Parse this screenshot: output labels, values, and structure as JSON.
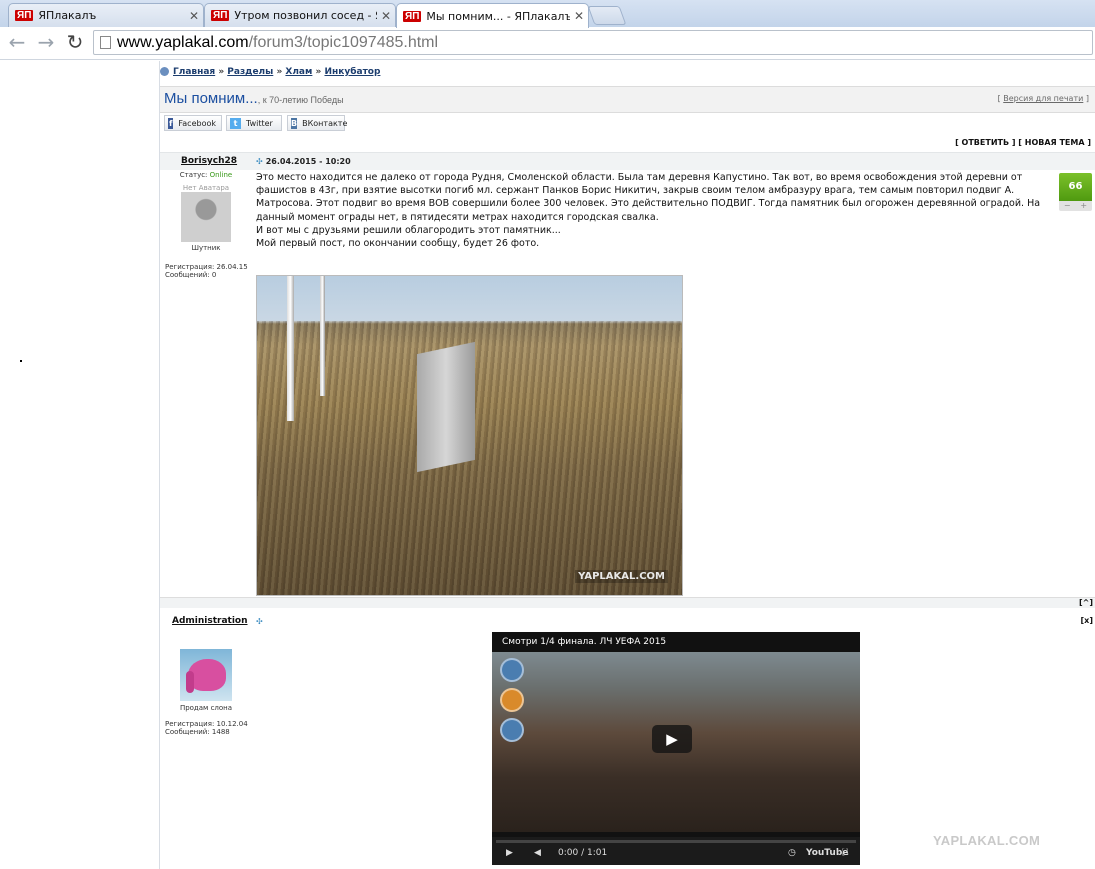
{
  "browser": {
    "tabs": [
      {
        "favicon": "ЯП",
        "title": "ЯПлакалъ"
      },
      {
        "favicon": "ЯП",
        "title": "Утром позвонил сосед - ЯП"
      },
      {
        "favicon": "ЯП",
        "title": "Мы помним... - ЯПлакалъ"
      }
    ],
    "url_host": "www.yaplakal.com",
    "url_path": "/forum3/topic1097485.html"
  },
  "breadcrumbs": [
    "Главная",
    "Разделы",
    "Хлам",
    "Инкубатор"
  ],
  "breadcrumb_sep": "»",
  "topic": {
    "title": "Мы помним...",
    "subtitle": ", к 70-летию Победы",
    "print_version": "Версия для печати"
  },
  "share": [
    {
      "label": "Facebook",
      "icon": "f",
      "color": "#3b5998"
    },
    {
      "label": "Twitter",
      "icon": "t",
      "color": "#55acee"
    },
    {
      "label": "ВКонтакте",
      "icon": "В",
      "color": "#4c75a3"
    }
  ],
  "actions": "[ ОТВЕТИТЬ ] [ НОВАЯ ТЕМА ]",
  "posts": [
    {
      "author": "Borisych28",
      "date": "26.04.2015 - 10:20",
      "status_label": "Статус:",
      "status": "Online",
      "avatar_text": "Нет Аватара",
      "rank": "Шутник",
      "registered": "Регистрация: 26.04.15",
      "messages": "Сообщений: 0",
      "rating": "66",
      "rating_minus": "−",
      "rating_plus": "+",
      "text1": "Это место находится не далеко от города Рудня, Смоленской области. Была там деревня Капустино. Так вот, во время освобождения этой деревни от фашистов в 43г, при взятие высотки погиб мл. сержант Панков Борис Никитич, закрыв своим телом амбразуру врага, тем самым повторил подвиг А. Матросова. Этот подвиг во время ВОВ совершили более 300 человек. Это действительно ПОДВИГ. Тогда памятник был огорожен деревянной оградой. На данный момент ограды нет, в пятидесяти метрах находится городская свалка.",
      "text2": "И вот мы с друзьями решили облагородить этот памятник...",
      "text3": "Мой первый пост, по окончании сообщу, будет 26 фото.",
      "photo_watermark": "YAPLAKAL.COM"
    },
    {
      "author": "Administration",
      "rank": "Продам слона",
      "registered": "Регистрация: 10.12.04",
      "messages": "Сообщений: 1488"
    }
  ],
  "top_button": "[^]",
  "close_button": "[x]",
  "video": {
    "title": "Смотри 1/4 финала. ЛЧ УЕФА 2015",
    "time": "0:00 / 1:01",
    "brand": "YouTube",
    "progress": 0.0
  },
  "site_watermark": "YAPLAKAL.COM"
}
